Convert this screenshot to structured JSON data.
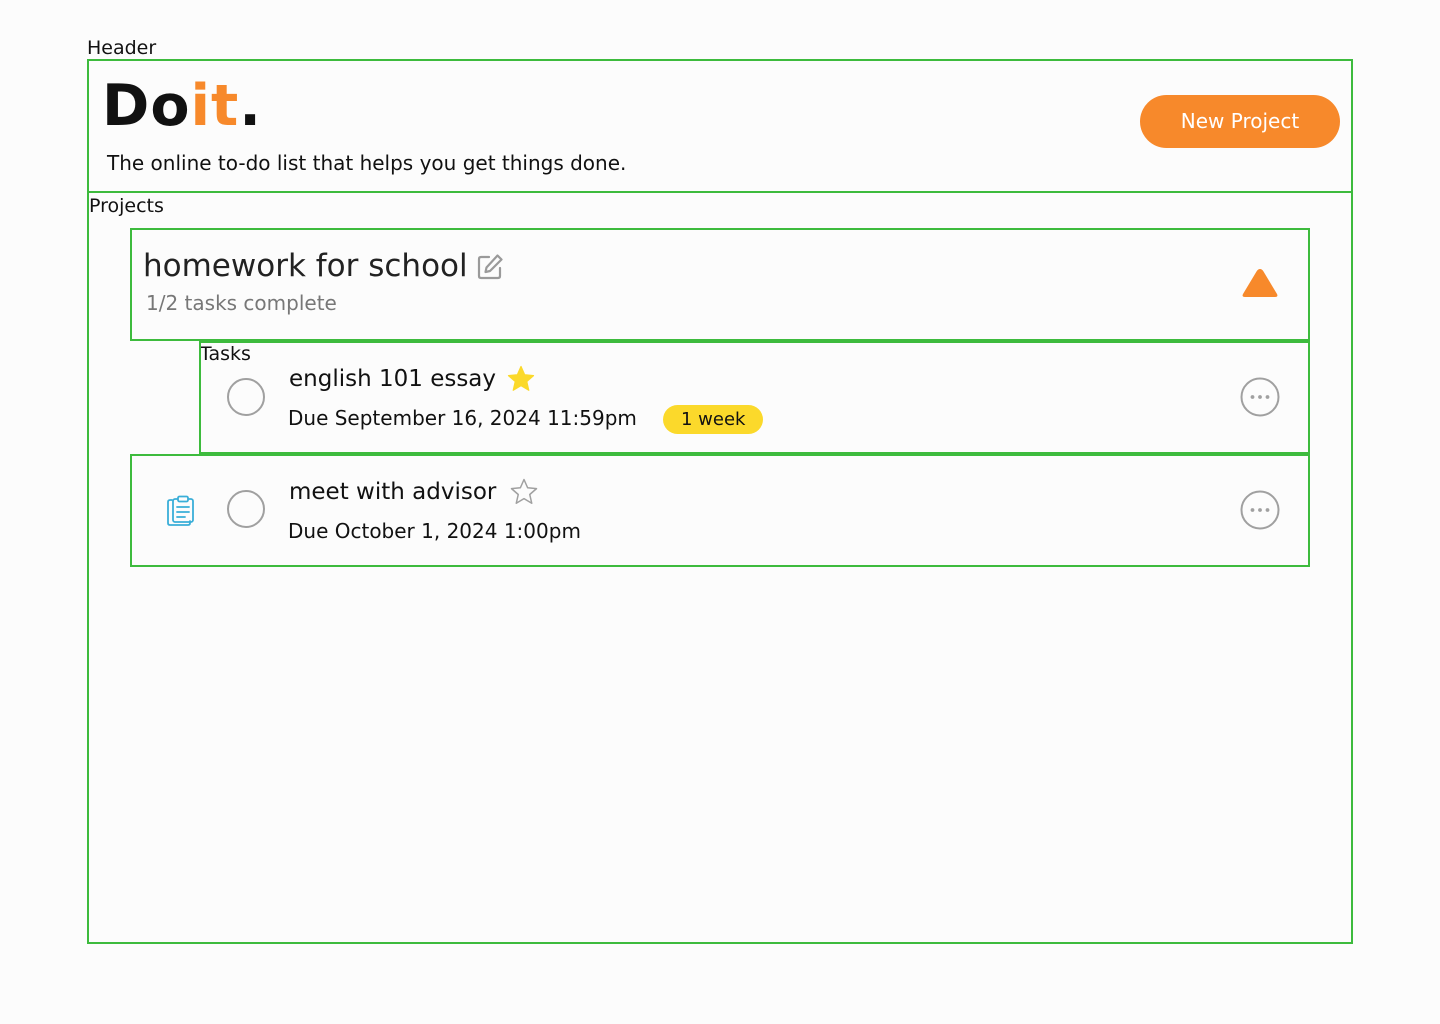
{
  "labels": {
    "header": "Header",
    "projects": "Projects",
    "tasks": "Tasks"
  },
  "header": {
    "logo_part1": "Do",
    "logo_part2": "it",
    "logo_part3": ".",
    "tagline": "The online to-do list that helps you get things done.",
    "new_project_label": "New Project"
  },
  "project": {
    "title": "homework for school",
    "progress": "1/2 tasks complete",
    "expanded": true
  },
  "tasks": [
    {
      "title": "english 101 essay",
      "due": "Due September 16, 2024 11:59pm",
      "starred": true,
      "badge": "1 week",
      "completed": false
    },
    {
      "title": "meet with advisor",
      "due": "Due October 1, 2024 1:00pm",
      "starred": false,
      "completed": false
    }
  ],
  "colors": {
    "accent": "#f7892b",
    "outline": "#3dbb3d",
    "star": "#fbd92b",
    "badge": "#fbd92b",
    "clipboard": "#3aaed8",
    "muted": "#a0a0a0"
  },
  "icons": {
    "edit": "edit-icon",
    "collapse": "triangle-up-icon",
    "star_filled": "star-filled-icon",
    "star_outline": "star-outline-icon",
    "more": "more-options-icon",
    "clipboard": "clipboard-icon"
  }
}
